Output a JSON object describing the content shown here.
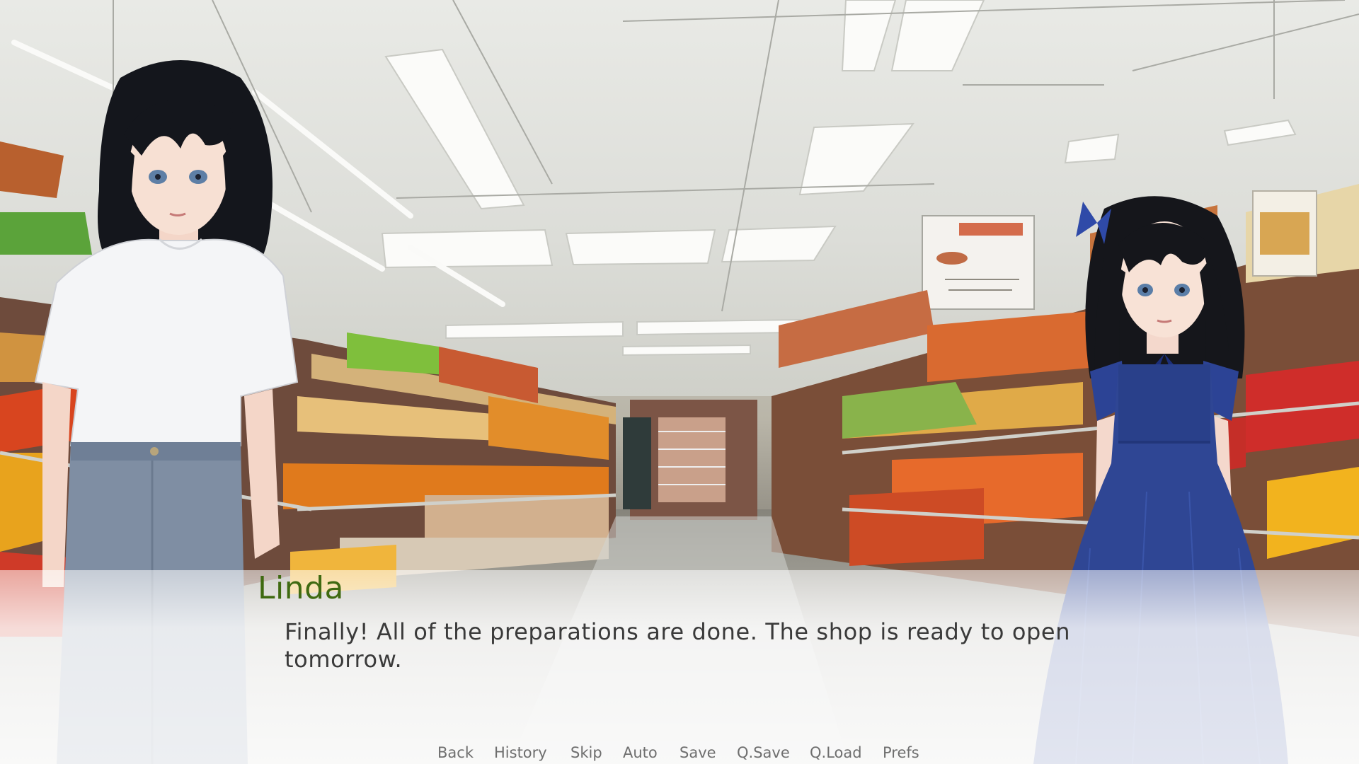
{
  "dialogue": {
    "speaker": "Linda",
    "speaker_color": "#3f6a11",
    "text": "Finally! All of the preparations are done. The shop is ready to open tomorrow."
  },
  "quick_menu": {
    "back": "Back",
    "history": "History",
    "skip": "Skip",
    "auto": "Auto",
    "save": "Save",
    "qsave": "Q.Save",
    "qload": "Q.Load",
    "prefs": "Prefs"
  },
  "scene": {
    "background": "supermarket-aisle",
    "characters": [
      "woman-white-tshirt-jeans",
      "girl-blue-dress"
    ]
  }
}
